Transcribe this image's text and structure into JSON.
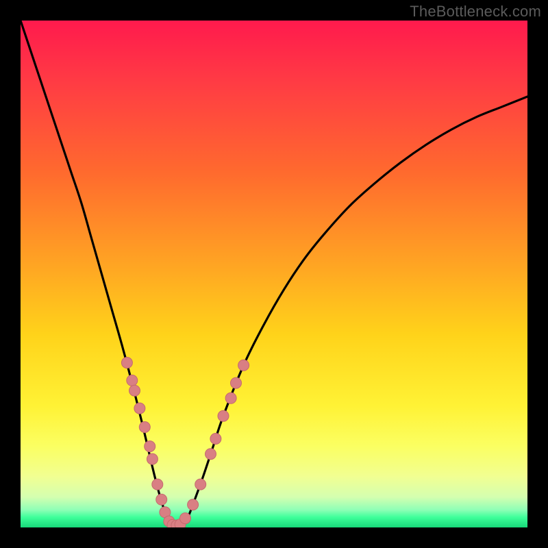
{
  "watermark": "TheBottleneck.com",
  "colors": {
    "frame": "#000000",
    "curve": "#000000",
    "marker_fill": "#d97f83",
    "marker_stroke": "#c46a6e",
    "gradient_stops": [
      {
        "pct": 0,
        "color": "#ff1a4d"
      },
      {
        "pct": 12,
        "color": "#ff3b44"
      },
      {
        "pct": 30,
        "color": "#ff6a2e"
      },
      {
        "pct": 48,
        "color": "#ffa423"
      },
      {
        "pct": 62,
        "color": "#ffd31a"
      },
      {
        "pct": 76,
        "color": "#fff235"
      },
      {
        "pct": 84,
        "color": "#fbff62"
      },
      {
        "pct": 90,
        "color": "#f1ff92"
      },
      {
        "pct": 94,
        "color": "#d4ffb0"
      },
      {
        "pct": 96.5,
        "color": "#8fffb6"
      },
      {
        "pct": 98,
        "color": "#3dff9a"
      },
      {
        "pct": 100,
        "color": "#17d879"
      }
    ]
  },
  "chart_data": {
    "type": "line",
    "title": "",
    "xlabel": "",
    "ylabel": "",
    "xlim": [
      0,
      100
    ],
    "ylim": [
      0,
      100
    ],
    "series": [
      {
        "name": "bottleneck-curve",
        "x": [
          0,
          2,
          4,
          6,
          8,
          10,
          12,
          14,
          16,
          18,
          20,
          22,
          24,
          26,
          27,
          28,
          29,
          30,
          31,
          32,
          33,
          34,
          36,
          38,
          40,
          44,
          48,
          52,
          56,
          60,
          65,
          70,
          75,
          80,
          85,
          90,
          95,
          100
        ],
        "y": [
          100,
          94,
          88,
          82,
          76,
          70,
          64,
          57,
          50,
          43,
          36,
          28.5,
          20.5,
          12,
          8,
          4.5,
          2,
          0.6,
          0.2,
          0.6,
          2,
          4.5,
          10,
          16,
          22,
          32,
          40,
          47,
          53,
          58,
          63.5,
          68,
          72,
          75.5,
          78.5,
          81,
          83,
          85
        ]
      }
    ],
    "markers": {
      "name": "highlighted-points",
      "points": [
        {
          "x": 21.0,
          "y": 32.5
        },
        {
          "x": 22.0,
          "y": 29.0
        },
        {
          "x": 22.5,
          "y": 27.0
        },
        {
          "x": 23.5,
          "y": 23.5
        },
        {
          "x": 24.5,
          "y": 19.8
        },
        {
          "x": 25.5,
          "y": 16.0
        },
        {
          "x": 26.0,
          "y": 13.5
        },
        {
          "x": 27.0,
          "y": 8.5
        },
        {
          "x": 27.8,
          "y": 5.5
        },
        {
          "x": 28.5,
          "y": 3.0
        },
        {
          "x": 29.3,
          "y": 1.2
        },
        {
          "x": 30.0,
          "y": 0.5
        },
        {
          "x": 30.8,
          "y": 0.4
        },
        {
          "x": 31.5,
          "y": 0.6
        },
        {
          "x": 32.5,
          "y": 1.8
        },
        {
          "x": 34.0,
          "y": 4.5
        },
        {
          "x": 35.5,
          "y": 8.5
        },
        {
          "x": 37.5,
          "y": 14.5
        },
        {
          "x": 38.5,
          "y": 17.5
        },
        {
          "x": 40.0,
          "y": 22.0
        },
        {
          "x": 41.5,
          "y": 25.5
        },
        {
          "x": 42.5,
          "y": 28.5
        },
        {
          "x": 44.0,
          "y": 32.0
        }
      ]
    }
  }
}
